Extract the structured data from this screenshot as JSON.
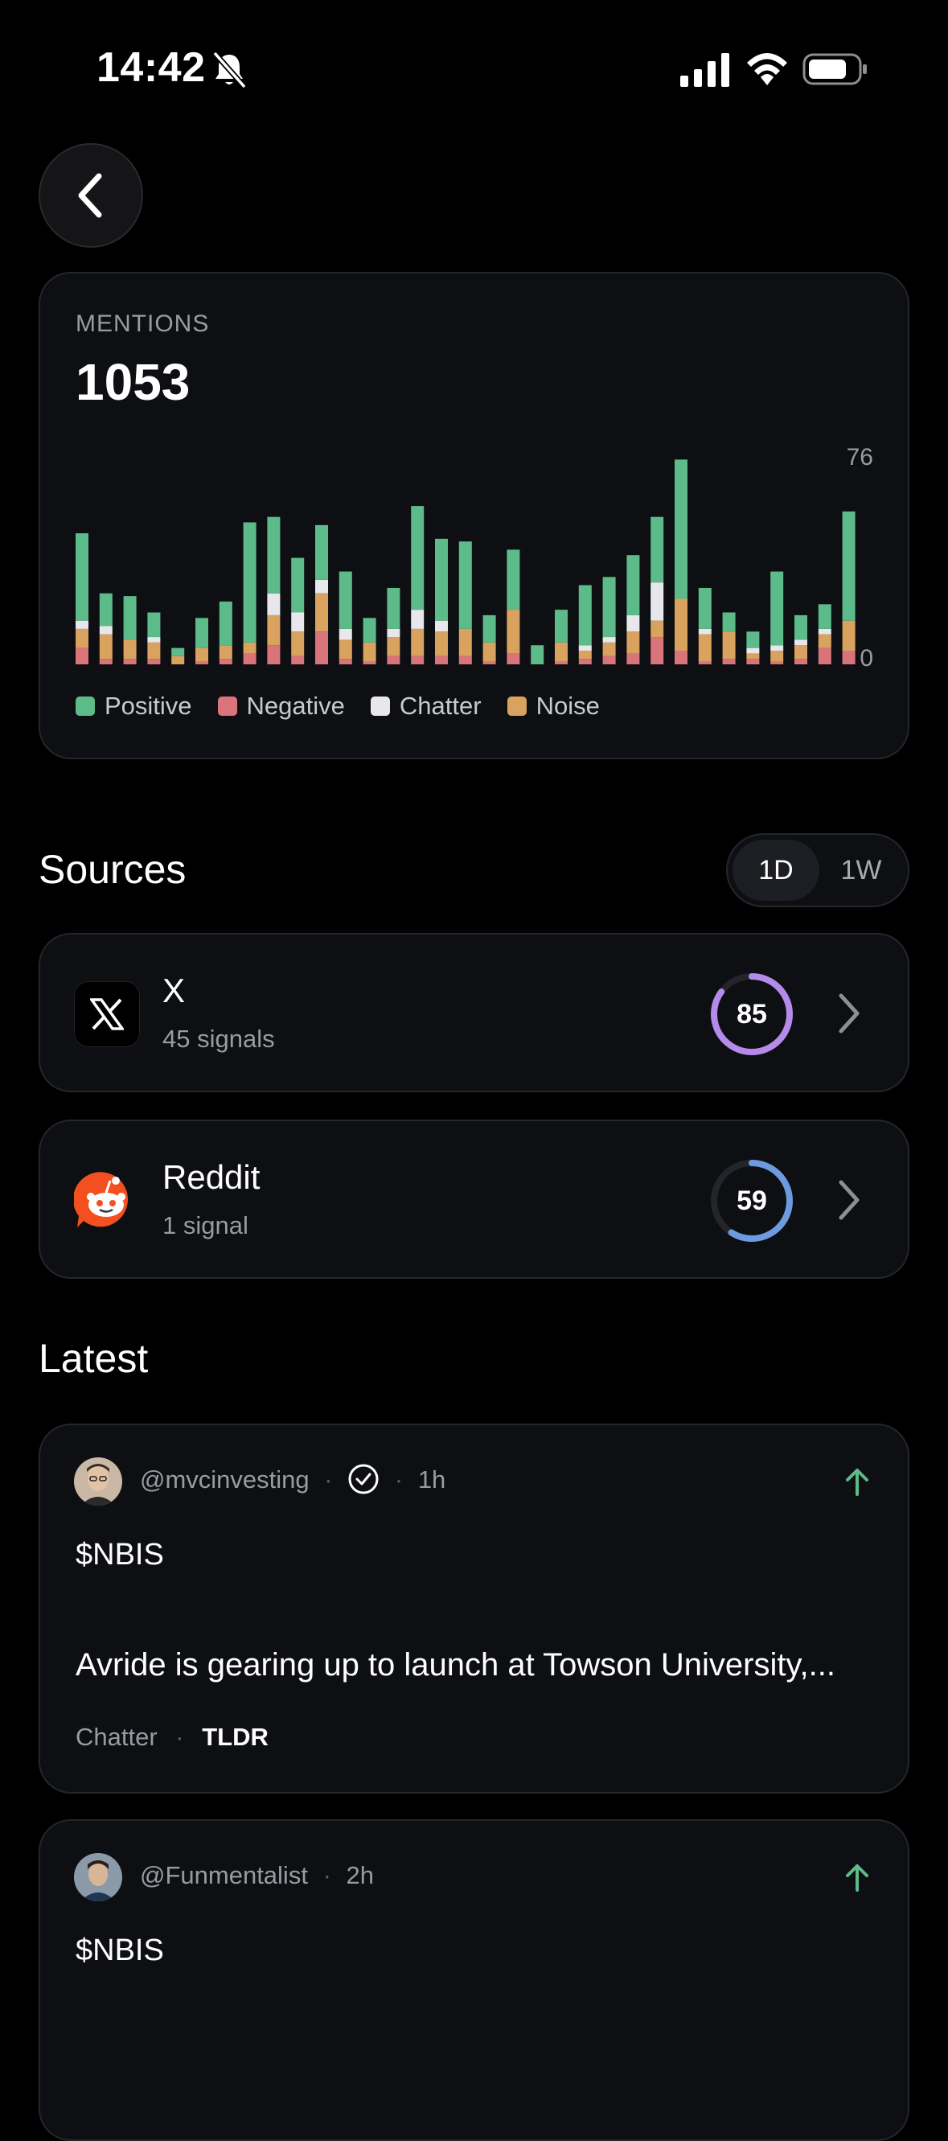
{
  "status_bar": {
    "time": "14:42"
  },
  "mentions": {
    "label": "MENTIONS",
    "count": "1053",
    "y_max_label": "76",
    "y_min_label": "0",
    "legend": [
      {
        "label": "Positive",
        "color": "#5dbb8a"
      },
      {
        "label": "Negative",
        "color": "#d9747a"
      },
      {
        "label": "Chatter",
        "color": "#e8e8ec"
      },
      {
        "label": "Noise",
        "color": "#d9a35f"
      }
    ]
  },
  "chart_data": {
    "type": "bar",
    "stacked": true,
    "ylim": [
      0,
      76
    ],
    "y_tick_labels": [
      "76",
      "0"
    ],
    "series": [
      {
        "name": "Negative",
        "color": "#d9747a",
        "values": [
          6,
          2,
          2,
          2,
          0,
          1,
          2,
          4,
          7,
          3,
          12,
          2,
          1,
          3,
          3,
          3,
          3,
          1,
          4,
          0,
          1,
          2,
          3,
          4,
          10,
          5,
          1,
          2,
          2,
          1,
          2,
          6,
          5
        ]
      },
      {
        "name": "Noise",
        "color": "#d9a35f",
        "values": [
          7,
          9,
          7,
          6,
          3,
          5,
          5,
          4,
          11,
          9,
          14,
          7,
          7,
          7,
          10,
          9,
          10,
          7,
          16,
          0,
          7,
          3,
          5,
          8,
          6,
          19,
          10,
          10,
          2,
          4,
          5,
          5,
          11
        ]
      },
      {
        "name": "Chatter",
        "color": "#e8e8ec",
        "values": [
          3,
          3,
          0,
          2,
          0,
          0,
          0,
          0,
          8,
          7,
          5,
          4,
          0,
          3,
          7,
          4,
          0,
          0,
          0,
          0,
          0,
          2,
          2,
          6,
          14,
          0,
          2,
          0,
          2,
          2,
          2,
          2,
          0
        ]
      },
      {
        "name": "Positive",
        "color": "#5dbb8a",
        "values": [
          32,
          12,
          16,
          9,
          3,
          11,
          16,
          44,
          28,
          20,
          20,
          21,
          9,
          15,
          38,
          30,
          32,
          10,
          22,
          7,
          12,
          22,
          22,
          22,
          24,
          51,
          15,
          7,
          6,
          27,
          9,
          9,
          40
        ]
      }
    ],
    "legend_position": "bottom"
  },
  "sources": {
    "title": "Sources",
    "toggle": [
      "1D",
      "1W"
    ],
    "selected": "1D",
    "items": [
      {
        "name": "X",
        "sub": "45 signals",
        "score": "85",
        "score_pct": 85,
        "ring_color": "#b48bea"
      },
      {
        "name": "Reddit",
        "sub": "1 signal",
        "score": "59",
        "score_pct": 59,
        "ring_color": "#6d9be0"
      }
    ]
  },
  "latest": {
    "title": "Latest",
    "posts": [
      {
        "handle": "@mvcinvesting",
        "time": "1h",
        "ticker": "$NBIS",
        "body": "Avride is gearing up to launch at Towson University,...",
        "tag": "Chatter",
        "tldr": "TLDR"
      },
      {
        "handle": "@Funmentalist",
        "time": "2h",
        "ticker": "$NBIS"
      }
    ]
  },
  "icons": {
    "back": "chevron-left-icon",
    "bell": "bell-slash-icon",
    "signal": "cellular-signal-icon",
    "wifi": "wifi-icon",
    "battery": "battery-icon",
    "verified": "check-circle-icon",
    "trend": "arrow-up-icon",
    "chevron": "chevron-right-icon"
  }
}
